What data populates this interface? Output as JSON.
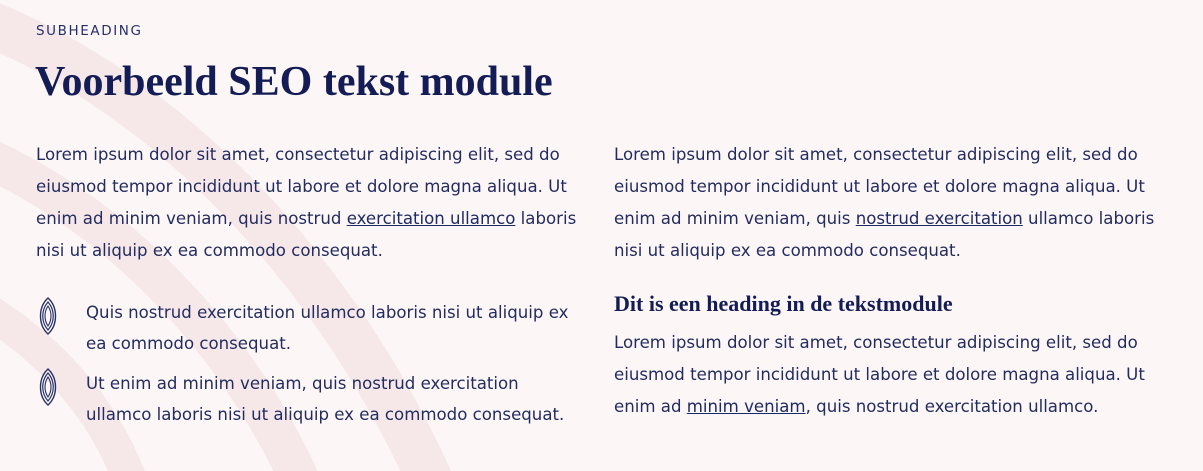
{
  "header": {
    "subheading": "SUBHEADING",
    "title": "Voorbeeld SEO tekst module"
  },
  "left_column": {
    "paragraph": {
      "line1": "Lorem ipsum dolor sit amet, consectetur adipiscing elit, sed do",
      "line2": "eiusmod tempor incididunt ut labore et dolore magna aliqua. Ut",
      "line3_before": "enim ad minim veniam, quis nostrud ",
      "line3_link": "exercitation ullamco",
      "line3_after": " laboris",
      "line4": "nisi ut aliquip ex ea commodo consequat."
    },
    "list_items": [
      {
        "icon": "leaf-outline-icon",
        "line1": "Quis nostrud exercitation ullamco laboris nisi ut aliquip ex",
        "line2": "ea commodo consequat."
      },
      {
        "icon": "leaf-outline-icon",
        "line1": "Ut enim ad minim veniam, quis nostrud exercitation",
        "line2": "ullamco laboris nisi ut aliquip ex ea commodo consequat."
      }
    ]
  },
  "right_column": {
    "paragraph": {
      "line1": "Lorem ipsum dolor sit amet, consectetur adipiscing elit, sed do",
      "line2": "eiusmod tempor incididunt ut labore et dolore magna aliqua. Ut",
      "line3_before": "enim ad minim veniam, quis ",
      "line3_link": "nostrud exercitation",
      "line3_after": " ullamco laboris",
      "line4": "nisi ut aliquip ex ea commodo consequat."
    },
    "heading": "Dit is een heading in de tekstmodule",
    "paragraph2": {
      "line1": "Lorem ipsum dolor sit amet, consectetur adipiscing elit, sed do",
      "line2": "eiusmod tempor incididunt ut labore et dolore magna aliqua. Ut",
      "line3_before": "enim ad ",
      "line3_link": "minim veniam",
      "line3_after": ", quis nostrud exercitation ullamco."
    }
  },
  "colors": {
    "background": "#fcf7f6",
    "text": "#232c60",
    "heading": "#141c56",
    "decorative_arc": "#f5e6e6"
  }
}
